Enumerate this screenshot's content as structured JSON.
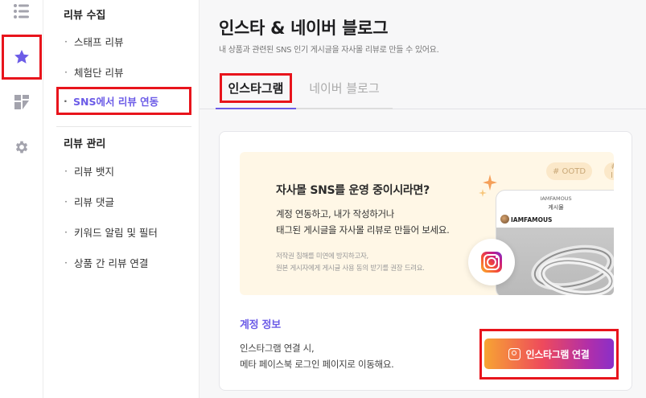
{
  "rail": {
    "items": [
      {
        "icon": "list-icon"
      },
      {
        "icon": "star-icon",
        "active": true
      },
      {
        "icon": "dashboard-icon"
      },
      {
        "icon": "gear-icon"
      }
    ]
  },
  "subnav": {
    "groups": [
      {
        "title": "리뷰 수집",
        "items": [
          {
            "label": "스태프 리뷰"
          },
          {
            "label": "체험단 리뷰"
          },
          {
            "label": "SNS에서 리뷰 연동",
            "active": true
          }
        ]
      },
      {
        "title": "리뷰 관리",
        "items": [
          {
            "label": "리뷰 뱃지"
          },
          {
            "label": "리뷰 댓글"
          },
          {
            "label": "키워드 알림 및 필터"
          },
          {
            "label": "상품 간 리뷰 연결"
          }
        ]
      }
    ],
    "bullet": "·"
  },
  "header": {
    "title": "인스타 & 네이버 블로그",
    "subtitle": "내 상품과 관련된 SNS 인기 게시글을 자사몰 리뷰로 만들 수 있어요."
  },
  "tabs": [
    {
      "label": "인스타그램",
      "active": true
    },
    {
      "label": "네이버 블로그",
      "active": false
    }
  ],
  "promo": {
    "headline": "자사몰 SNS를 운영 중이시라면?",
    "body_line1": "계정 연동하고, 내가 작성하거나",
    "body_line2": "태그된 게시글을 자사몰 리뷰로 만들어 보세요.",
    "note_line1": "저작권 침해를 미연에 방지하고자,",
    "note_line2": "원본 게시자에게 게시글 사용 동의 받기를 권장 드려요.",
    "hashtags": [
      "# OOTD",
      "# I"
    ],
    "phone_account": "IAMFAMOUS",
    "phone_label": "게시물",
    "phone_user": "IAMFAMOUS"
  },
  "account": {
    "title": "계정 정보",
    "desc_line1": "인스타그램 연결 시,",
    "desc_line2": "메타 페이스북 로그인 페이지로 이동해요.",
    "connect_label": "인스타그램 연결"
  },
  "colors": {
    "accent": "#6c5ce7",
    "highlight": "#e8141c",
    "promo_bg": "#fff7e6"
  }
}
